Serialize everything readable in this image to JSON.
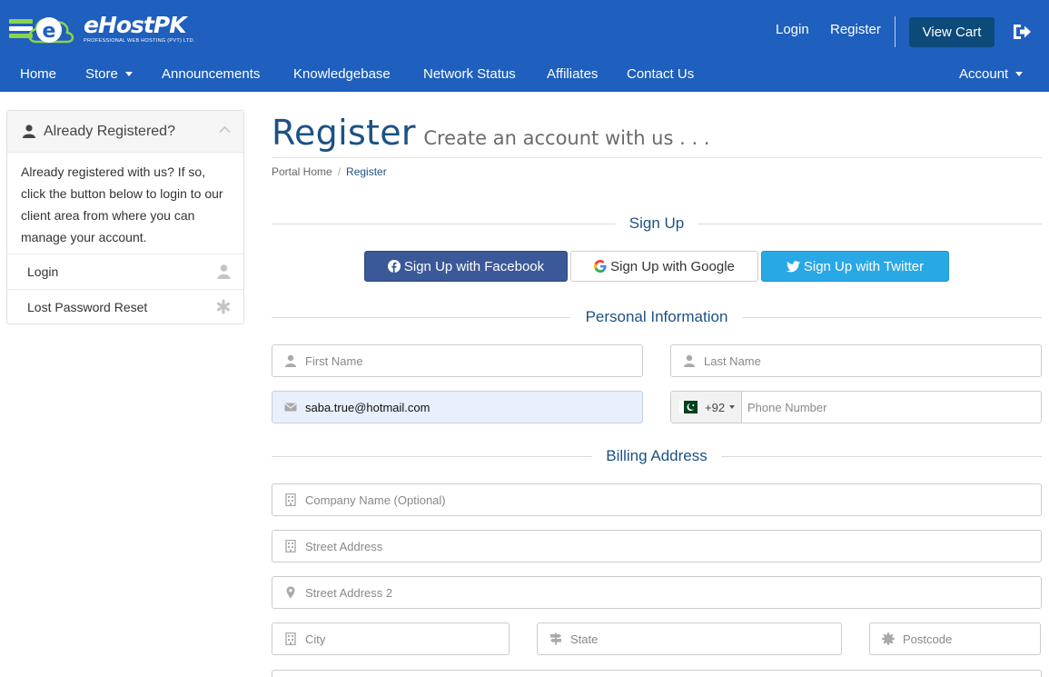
{
  "brand": {
    "name": "eHostPK",
    "tagline": "PROFESSIONAL WEB HOSTING (PVT) LTD."
  },
  "topbar": {
    "login": "Login",
    "register": "Register",
    "view_cart": "View Cart",
    "logout_icon": "sign-out-icon"
  },
  "nav": {
    "items": [
      {
        "label": "Home"
      },
      {
        "label": "Store"
      },
      {
        "label": "Announcements"
      },
      {
        "label": "Knowledgebase"
      },
      {
        "label": "Network Status"
      },
      {
        "label": "Affiliates"
      },
      {
        "label": "Contact Us"
      }
    ],
    "account": "Account"
  },
  "sidebar": {
    "title": "Already Registered?",
    "body": "Already registered with us? If so, click the button below to login to our client area from where you can manage your account.",
    "items": [
      {
        "label": "Login",
        "icon": "user-icon"
      },
      {
        "label": "Lost Password Reset",
        "icon": "asterisk-icon"
      }
    ]
  },
  "page": {
    "title": "Register",
    "subtitle": "Create an account with us . . .",
    "breadcrumb": [
      "Portal Home",
      "Register"
    ]
  },
  "signup": {
    "heading": "Sign Up",
    "facebook": "Sign Up with Facebook",
    "google": "Sign Up with Google",
    "twitter": "Sign Up with Twitter"
  },
  "personal": {
    "heading": "Personal Information",
    "first_name_placeholder": "First Name",
    "last_name_placeholder": "Last Name",
    "email_value": "saba.true@hotmail.com",
    "phone_code": "+92",
    "phone_placeholder": "Phone Number"
  },
  "billing": {
    "heading": "Billing Address",
    "company_placeholder": "Company Name (Optional)",
    "street_placeholder": "Street Address",
    "street2_placeholder": "Street Address 2",
    "city_placeholder": "City",
    "state_placeholder": "State",
    "postcode_placeholder": "Postcode"
  },
  "colors": {
    "header": "#1f5fbd",
    "view_cart": "#0c4a7a",
    "facebook": "#3b5998",
    "twitter": "#29a8e6",
    "heading_blue": "#1c5186"
  }
}
